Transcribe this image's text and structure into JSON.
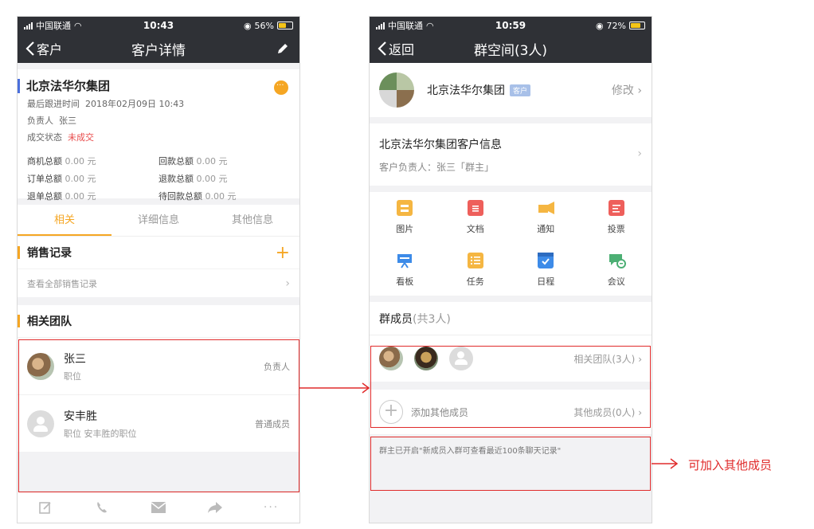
{
  "statusbar": {
    "carrier": "中国联通",
    "left_time": "10:43",
    "left_battery": "56%",
    "right_time": "10:59",
    "right_battery": "72%"
  },
  "customer_detail": {
    "nav_back": "客户",
    "nav_title": "客户详情",
    "company_name": "北京法华尔集团",
    "last_follow_label": "最后跟进时间",
    "last_follow_value": "2018年02月09日 10:43",
    "owner_label": "负责人",
    "owner_value": "张三",
    "deal_label": "成交状态",
    "deal_value": "未成交",
    "totals": [
      {
        "label": "商机总额",
        "value": "0.00 元"
      },
      {
        "label": "回款总额",
        "value": "0.00 元"
      },
      {
        "label": "订单总额",
        "value": "0.00 元"
      },
      {
        "label": "退款总额",
        "value": "0.00 元"
      },
      {
        "label": "退单总额",
        "value": "0.00 元"
      },
      {
        "label": "待回款总额",
        "value": "0.00 元"
      }
    ],
    "tabs": [
      "相关",
      "详细信息",
      "其他信息"
    ],
    "sales_title": "销售记录",
    "sales_link": "查看全部销售记录",
    "team_title": "相关团队",
    "team_members": [
      {
        "name": "张三",
        "sub": "职位",
        "role": "负责人"
      },
      {
        "name": "安丰胜",
        "sub": "职位 安丰胜的职位",
        "role": "普通成员"
      }
    ]
  },
  "group_space": {
    "nav_back": "返回",
    "nav_title": "群空间(3人)",
    "group_name": "北京法华尔集团",
    "group_tag": "客户",
    "edit_label": "修改",
    "info_title": "北京法华尔集团客户信息",
    "info_sub": "客户负责人：张三「群主」",
    "features": [
      {
        "label": "图片",
        "icon": "image-icon",
        "color": "#f5b642"
      },
      {
        "label": "文档",
        "icon": "document-icon",
        "color": "#ee5f5b"
      },
      {
        "label": "通知",
        "icon": "megaphone-icon",
        "color": "#f5b642"
      },
      {
        "label": "投票",
        "icon": "vote-icon",
        "color": "#ee5f5b"
      },
      {
        "label": "看板",
        "icon": "board-icon",
        "color": "#3d8be8"
      },
      {
        "label": "任务",
        "icon": "task-icon",
        "color": "#f5b642"
      },
      {
        "label": "日程",
        "icon": "calendar-icon",
        "color": "#3d8be8"
      },
      {
        "label": "会议",
        "icon": "meeting-icon",
        "color": "#4caf74"
      }
    ],
    "members_title": "群成员",
    "members_count": "(共3人)",
    "related_team": "相关团队(3人)",
    "add_label": "添加其他成员",
    "other_members": "其他成员(0人)",
    "notice": "群主已开启\"新成员入群可查看最近100条聊天记录\""
  },
  "annotation": {
    "text": "可加入其他成员",
    "color": "#e02b2b"
  }
}
